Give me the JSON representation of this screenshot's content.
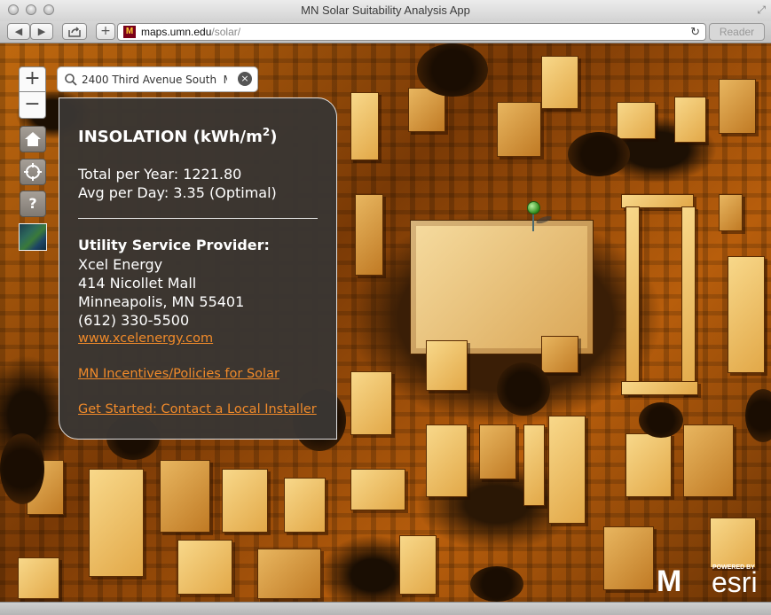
{
  "window": {
    "title": "MN Solar Suitability Analysis App"
  },
  "toolbar": {
    "url_host": "maps.umn.edu",
    "url_path": "/solar/",
    "reader_label": "Reader",
    "url_logo": "M"
  },
  "map": {
    "zoom_in_label": "+",
    "zoom_out_label": "−",
    "help_label": "?",
    "search": {
      "value": "2400 Third Avenue South  M"
    },
    "clear_label": "×"
  },
  "panel": {
    "title": "INSOLATION (kWh/m",
    "title_sup": "2",
    "title_end": ")",
    "total_per_year": "Total per Year: 1221.80",
    "avg_per_day": "Avg per Day: 3.35 (Optimal)",
    "utility_heading": "Utility Service Provider:",
    "utility_name": "Xcel Energy",
    "utility_address1": "414 Nicollet Mall",
    "utility_address2": "Minneapolis, MN 55401",
    "utility_phone": "(612) 330-5500",
    "utility_url": "www.xcelenergy.com",
    "incentives_link": "MN Incentives/Policies for Solar",
    "installer_link": "Get Started: Contact a Local Installer"
  },
  "logos": {
    "umn": "M",
    "esri_powered": "POWERED BY",
    "esri": "esri"
  },
  "colors": {
    "panel_bg": "#3a3632",
    "link": "#f08a2a",
    "umn_maroon": "#7a0019",
    "umn_gold": "#ffcc33"
  }
}
